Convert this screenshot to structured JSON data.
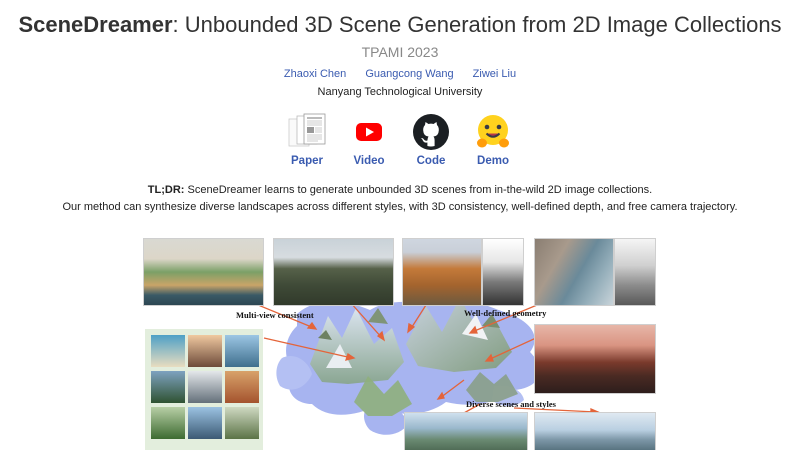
{
  "header": {
    "title_bold": "SceneDreamer",
    "title_rest": ": Unbounded 3D Scene Generation from 2D Image Collections",
    "venue": "TPAMI 2023"
  },
  "authors": [
    "Zhaoxi Chen",
    "Guangcong Wang",
    "Ziwei Liu"
  ],
  "affiliation": "Nanyang Technological University",
  "links": [
    {
      "label": "Paper",
      "icon": "paper-icon"
    },
    {
      "label": "Video",
      "icon": "youtube-icon"
    },
    {
      "label": "Code",
      "icon": "github-icon"
    },
    {
      "label": "Demo",
      "icon": "huggingface-icon"
    }
  ],
  "tldr": {
    "label": "TL;DR:",
    "line1": "SceneDreamer learns to generate unbounded 3D scenes from in-the-wild 2D image collections.",
    "line2": "Our method can synthesize diverse landscapes across different styles, with 3D consistency, well-defined depth, and free camera trajectory."
  },
  "figure": {
    "labels": {
      "multiview": "Multi-view consistent",
      "geometry": "Well-defined geometry",
      "diverse": "Diverse scenes and styles"
    }
  },
  "colors": {
    "link": "#3a5bb0",
    "muted": "#888888",
    "arrow": "#e4643a",
    "map": "#a7b4f0"
  }
}
